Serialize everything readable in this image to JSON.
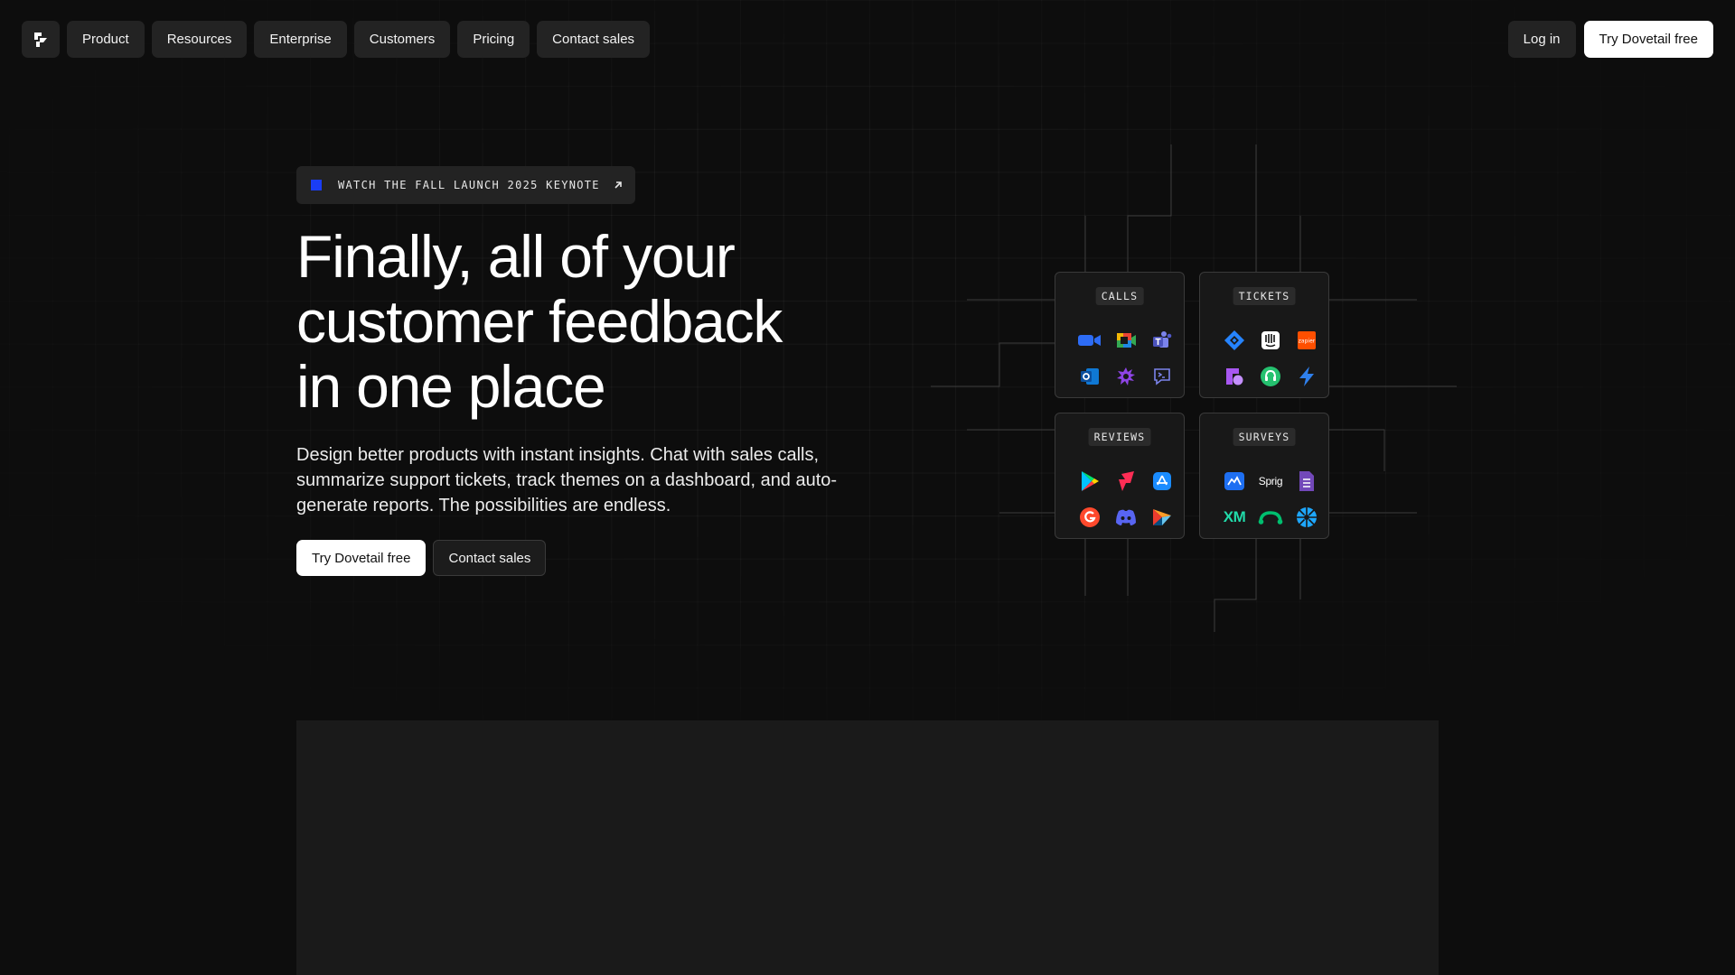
{
  "nav": {
    "logo_icon": "dovetail-logo-icon",
    "items": [
      {
        "label": "Product"
      },
      {
        "label": "Resources"
      },
      {
        "label": "Enterprise"
      },
      {
        "label": "Customers"
      },
      {
        "label": "Pricing"
      },
      {
        "label": "Contact sales"
      }
    ],
    "login_label": "Log in",
    "try_label": "Try Dovetail free"
  },
  "hero": {
    "badge_text": "WATCH THE FALL LAUNCH 2025 KEYNOTE",
    "badge_color": "#1a3df5",
    "headline_lines": [
      "Finally, all of your",
      "customer feedback",
      "in one place"
    ],
    "subtext": "Design better products with instant insights. Chat with sales calls, summarize support tickets, track themes on a dashboard, and auto-generate reports. The possibilities are endless.",
    "cta_primary": "Try Dovetail free",
    "cta_secondary": "Contact sales"
  },
  "integrations": {
    "calls": {
      "label": "CALLS",
      "icons": [
        "zoom-icon",
        "google-meet-icon",
        "microsoft-teams-icon",
        "outlook-icon",
        "gong-icon",
        "chat-prompt-icon"
      ]
    },
    "tickets": {
      "label": "TICKETS",
      "icons": [
        "jira-icon",
        "intercom-icon",
        "zapier-icon",
        "front-icon",
        "freshdesk-icon",
        "lightning-icon"
      ]
    },
    "reviews": {
      "label": "REVIEWS",
      "icons": [
        "google-play-icon",
        "bolt-red-icon",
        "app-store-icon",
        "g2-icon",
        "discord-icon",
        "capterra-icon"
      ]
    },
    "surveys": {
      "label": "SURVEYS",
      "icons": [
        "cloud-survey-icon",
        "sprig-icon",
        "google-forms-icon",
        "qualtrics-xm-icon",
        "surveymonkey-icon",
        "wheel-icon"
      ],
      "sprig_text": "Sprig",
      "xm_text": "XM"
    }
  }
}
